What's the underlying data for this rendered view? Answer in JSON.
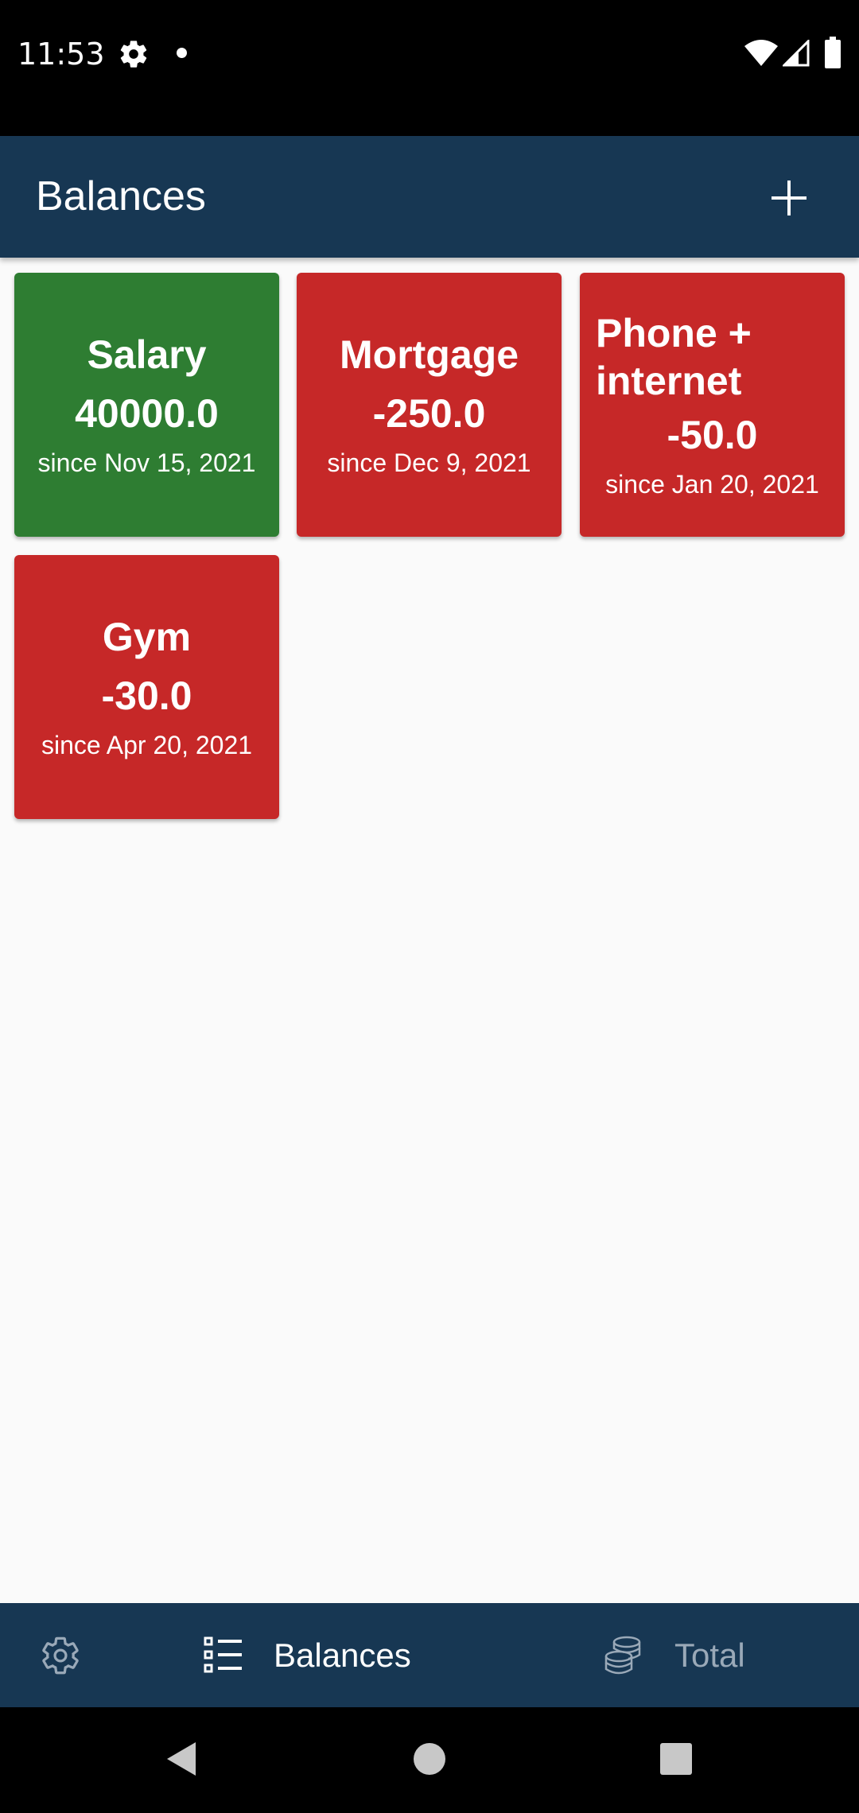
{
  "status_bar": {
    "time": "11:53"
  },
  "app_bar": {
    "title": "Balances",
    "add_icon": "plus-icon"
  },
  "colors": {
    "positive": "#2e7d32",
    "negative": "#c62828",
    "bar": "#173753"
  },
  "balances": [
    {
      "name": "Salary",
      "amount": "40000.0",
      "since": "since Nov 15, 2021",
      "status": "positive"
    },
    {
      "name": "Mortgage",
      "amount": "-250.0",
      "since": "since Dec 9, 2021",
      "status": "negative"
    },
    {
      "name": "Phone + internet",
      "amount": "-50.0",
      "since": "since Jan 20, 2021",
      "status": "negative"
    },
    {
      "name": "Gym",
      "amount": "-30.0",
      "since": "since Apr 20, 2021",
      "status": "negative"
    }
  ],
  "bottom_nav": {
    "settings_icon": "gear-icon",
    "balances_label": "Balances",
    "balances_icon": "list-icon",
    "total_label": "Total",
    "total_icon": "coins-icon"
  }
}
